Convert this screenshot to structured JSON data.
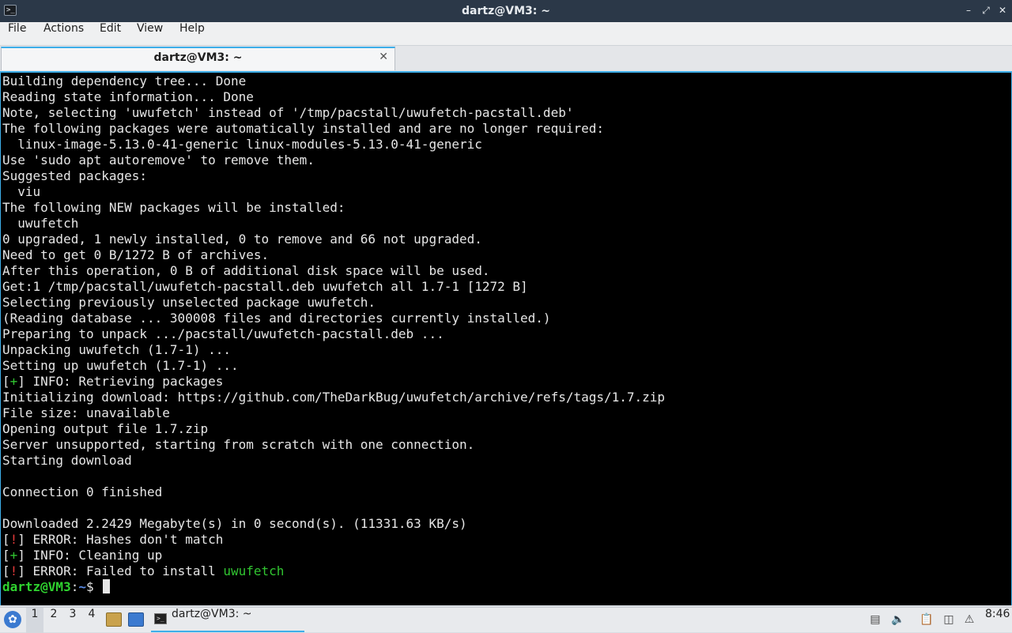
{
  "window": {
    "title": "dartz@VM3: ~"
  },
  "menubar": {
    "items": [
      "File",
      "Actions",
      "Edit",
      "View",
      "Help"
    ]
  },
  "tabs": [
    {
      "label": "dartz@VM3: ~"
    }
  ],
  "terminal": {
    "lines": [
      [
        {
          "t": "Building dependency tree... Done"
        }
      ],
      [
        {
          "t": "Reading state information... Done"
        }
      ],
      [
        {
          "t": "Note, selecting 'uwufetch' instead of '/tmp/pacstall/uwufetch-pacstall.deb'"
        }
      ],
      [
        {
          "t": "The following packages were automatically installed and are no longer required:"
        }
      ],
      [
        {
          "t": "  linux-image-5.13.0-41-generic linux-modules-5.13.0-41-generic"
        }
      ],
      [
        {
          "t": "Use 'sudo apt autoremove' to remove them."
        }
      ],
      [
        {
          "t": "Suggested packages:"
        }
      ],
      [
        {
          "t": "  viu"
        }
      ],
      [
        {
          "t": "The following NEW packages will be installed:"
        }
      ],
      [
        {
          "t": "  uwufetch"
        }
      ],
      [
        {
          "t": "0 upgraded, 1 newly installed, 0 to remove and 66 not upgraded."
        }
      ],
      [
        {
          "t": "Need to get 0 B/1272 B of archives."
        }
      ],
      [
        {
          "t": "After this operation, 0 B of additional disk space will be used."
        }
      ],
      [
        {
          "t": "Get:1 /tmp/pacstall/uwufetch-pacstall.deb uwufetch all 1.7-1 [1272 B]"
        }
      ],
      [
        {
          "t": "Selecting previously unselected package uwufetch."
        }
      ],
      [
        {
          "t": "(Reading database ... 300008 files and directories currently installed.)"
        }
      ],
      [
        {
          "t": "Preparing to unpack .../pacstall/uwufetch-pacstall.deb ..."
        }
      ],
      [
        {
          "t": "Unpacking uwufetch (1.7-1) ..."
        }
      ],
      [
        {
          "t": "Setting up uwufetch (1.7-1) ..."
        }
      ],
      [
        {
          "t": "["
        },
        {
          "t": "+",
          "c": "green"
        },
        {
          "t": "] INFO: Retrieving packages"
        }
      ],
      [
        {
          "t": "Initializing download: https://github.com/TheDarkBug/uwufetch/archive/refs/tags/1.7.zip"
        }
      ],
      [
        {
          "t": "File size: unavailable"
        }
      ],
      [
        {
          "t": "Opening output file 1.7.zip"
        }
      ],
      [
        {
          "t": "Server unsupported, starting from scratch with one connection."
        }
      ],
      [
        {
          "t": "Starting download"
        }
      ],
      [
        {
          "t": ""
        }
      ],
      [
        {
          "t": "Connection 0 finished"
        }
      ],
      [
        {
          "t": ""
        }
      ],
      [
        {
          "t": "Downloaded 2.2429 Megabyte(s) in 0 second(s). (11331.63 KB/s)"
        }
      ],
      [
        {
          "t": "["
        },
        {
          "t": "!",
          "c": "red"
        },
        {
          "t": "] ERROR: Hashes don't match"
        }
      ],
      [
        {
          "t": "["
        },
        {
          "t": "+",
          "c": "green"
        },
        {
          "t": "] INFO: Cleaning up"
        }
      ],
      [
        {
          "t": "["
        },
        {
          "t": "!",
          "c": "red"
        },
        {
          "t": "] ERROR: Failed to install "
        },
        {
          "t": "uwufetch",
          "c": "green"
        }
      ]
    ],
    "prompt": {
      "user_host": "dartz@VM3",
      "separator": ":",
      "path": "~",
      "symbol": "$ "
    }
  },
  "taskbar": {
    "workspaces": [
      "1",
      "2",
      "3",
      "4"
    ],
    "active_workspace": "1",
    "task_label": "dartz@VM3: ~",
    "clock": "8:46",
    "icons": {
      "start": "lubuntu-start-icon",
      "quicklaunch": [
        "file-manager-icon",
        "show-desktop-icon"
      ],
      "tray": [
        "volume-icon",
        "clipboard-icon",
        "network-icon",
        "update-notifier-icon"
      ]
    }
  }
}
